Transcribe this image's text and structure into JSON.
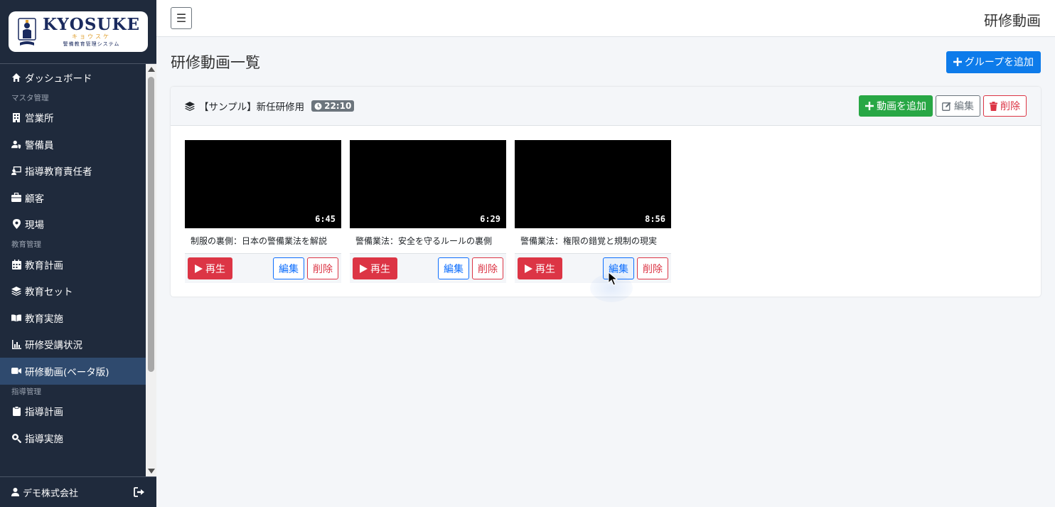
{
  "brand": {
    "name": "KYOSUKE",
    "kana": "キョウスケ",
    "tagline": "警備教育管理システム"
  },
  "sidebar": {
    "items": [
      {
        "type": "item",
        "label": "ダッシュボード",
        "icon": "home-icon"
      },
      {
        "type": "section",
        "label": "マスタ管理"
      },
      {
        "type": "item",
        "label": "営業所",
        "icon": "building-icon"
      },
      {
        "type": "item",
        "label": "警備員",
        "icon": "user-shield-icon"
      },
      {
        "type": "item",
        "label": "指導教育責任者",
        "icon": "chalkboard-teacher-icon"
      },
      {
        "type": "item",
        "label": "顧客",
        "icon": "briefcase-icon"
      },
      {
        "type": "item",
        "label": "現場",
        "icon": "map-pin-icon"
      },
      {
        "type": "section",
        "label": "教育管理"
      },
      {
        "type": "item",
        "label": "教育計画",
        "icon": "calendar-icon"
      },
      {
        "type": "item",
        "label": "教育セット",
        "icon": "layers-icon"
      },
      {
        "type": "item",
        "label": "教育実施",
        "icon": "book-open-icon"
      },
      {
        "type": "item",
        "label": "研修受講状況",
        "icon": "chart-icon"
      },
      {
        "type": "item",
        "label": "研修動画(ベータ版)",
        "icon": "video-icon",
        "active": true
      },
      {
        "type": "section",
        "label": "指導管理"
      },
      {
        "type": "item",
        "label": "指導計画",
        "icon": "clipboard-icon"
      },
      {
        "type": "item",
        "label": "指導実施",
        "icon": "search-icon"
      }
    ],
    "footer": {
      "user": "デモ株式会社"
    }
  },
  "header": {
    "title": "研修動画",
    "menu_glyph": "☰"
  },
  "main": {
    "title": "研修動画一覧",
    "add_group_label": "グループを追加",
    "group": {
      "title": "【サンプル】新任研修用",
      "total_duration": "22:10",
      "add_video_label": "動画を追加",
      "edit_label": "編集",
      "delete_label": "削除"
    },
    "videos": [
      {
        "title": "制服の裏側：日本の警備業法を解説",
        "duration": "6:45",
        "play_label": "再生",
        "edit_label": "編集",
        "delete_label": "削除"
      },
      {
        "title": "警備業法：安全を守るルールの裏側",
        "duration": "6:29",
        "play_label": "再生",
        "edit_label": "編集",
        "delete_label": "削除"
      },
      {
        "title": "警備業法：権限の錯覚と規制の現実",
        "duration": "8:56",
        "play_label": "再生",
        "edit_label": "編集",
        "delete_label": "削除"
      }
    ]
  },
  "colors": {
    "sidebar_bg": "#1f2a3c",
    "active_bg": "#2f4a6e",
    "primary": "#0d7bea",
    "success": "#28a745",
    "danger": "#dc3545",
    "secondary": "#6c757d"
  }
}
